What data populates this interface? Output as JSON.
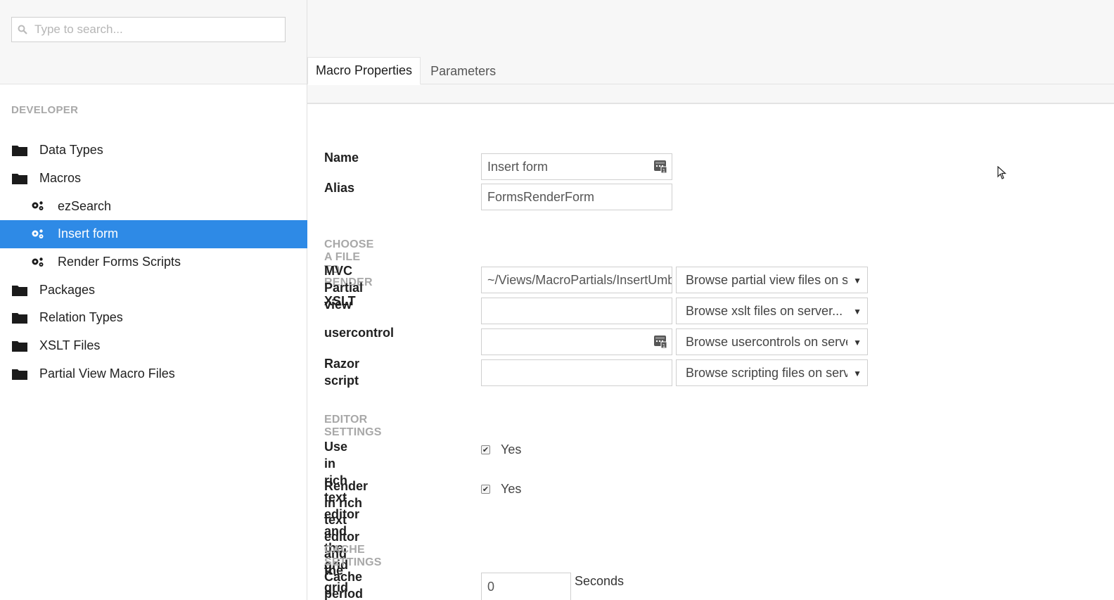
{
  "search": {
    "placeholder": "Type to search..."
  },
  "sidebar": {
    "section": "DEVELOPER",
    "items": [
      {
        "label": "Data Types",
        "icon": "folder-icon"
      },
      {
        "label": "Macros",
        "icon": "folder-icon"
      },
      {
        "label": "ezSearch",
        "icon": "gears-icon"
      },
      {
        "label": "Insert form",
        "icon": "gears-icon",
        "selected": true
      },
      {
        "label": "Render Forms Scripts",
        "icon": "gears-icon"
      },
      {
        "label": "Packages",
        "icon": "folder-icon"
      },
      {
        "label": "Relation Types",
        "icon": "folder-icon"
      },
      {
        "label": "XSLT Files",
        "icon": "folder-icon"
      },
      {
        "label": "Partial View Macro Files",
        "icon": "folder-icon"
      }
    ]
  },
  "tabs": [
    {
      "label": "Macro Properties",
      "active": true
    },
    {
      "label": "Parameters",
      "active": false
    }
  ],
  "form": {
    "name_label": "Name",
    "name_value": "Insert form",
    "alias_label": "Alias",
    "alias_value": "FormsRenderForm",
    "choose_head": "CHOOSE A FILE TO RENDER",
    "mvc_label": "MVC Partial view",
    "mvc_value": "~/Views/MacroPartials/InsertUmbracoFormWithTheme.cshtml",
    "mvc_select": "Browse partial view files on server...",
    "xslt_label": "XSLT",
    "xslt_value": "",
    "xslt_select": "Browse xslt files on server...",
    "usercontrol_label": "usercontrol",
    "usercontrol_value": "",
    "usercontrol_select": "Browse usercontrols on server...",
    "razor_label": "Razor script",
    "razor_value": "",
    "razor_select": "Browse scripting files on server...",
    "editor_head": "EDITOR SETTINGS",
    "use_rte_label_1": "Use in rich text editor",
    "use_rte_label_2": "and the grid",
    "use_rte_value": "Yes",
    "render_rte_label_1": "Render in rich text",
    "render_rte_label_2": "editor and the grid",
    "render_rte_value": "Yes",
    "cache_head": "CACHE SETTINGS",
    "cache_label": "Cache period",
    "cache_value": "0",
    "cache_unit": "Seconds"
  },
  "colors": {
    "selected": "#2e8ae6",
    "muted_heading": "#a8a8a8"
  }
}
